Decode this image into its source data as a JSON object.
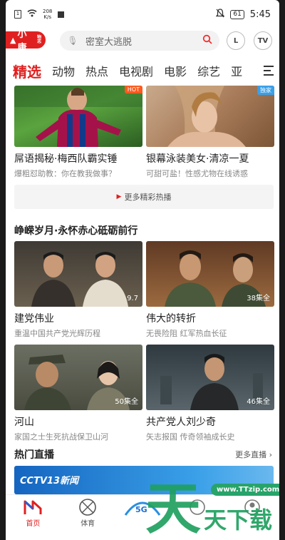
{
  "status": {
    "speed_num": "208",
    "speed_unit": "K/s",
    "battery": "61",
    "time": "5:45"
  },
  "header": {
    "logo_text": "小康",
    "logo_small": "物志",
    "search_placeholder": "密室大逃脱",
    "btn_l": "L",
    "btn_tv": "TV"
  },
  "tabs": [
    "精选",
    "动物",
    "热点",
    "电视剧",
    "电影",
    "综艺",
    "亚"
  ],
  "hot": {
    "items": [
      {
        "title": "屌语揭秘·梅西队霸实锤",
        "sub": "爆粗怼助教：你在教我做事？",
        "tag": "HOT"
      },
      {
        "title": "银幕泳装美女·清凉一夏",
        "sub": "可甜可盐！性感尤物在线诱惑",
        "tag": "独家"
      }
    ],
    "more": "更多精彩热播"
  },
  "section1": {
    "title": "峥嵘岁月·永怀赤心砥砺前行",
    "items": [
      {
        "title": "建党伟业",
        "sub": "重温中国共产党光辉历程",
        "badge": "9.7"
      },
      {
        "title": "伟大的转折",
        "sub": "无畏险阻 红军热血长征",
        "badge": "38集全"
      },
      {
        "title": "河山",
        "sub": "家国之士生死抗战保卫山河",
        "badge": "50集全"
      },
      {
        "title": "共产党人刘少奇",
        "sub": "矢志报国 传奇领袖成长史",
        "badge": "46集全"
      }
    ]
  },
  "live": {
    "title": "热门直播",
    "more": "更多直播",
    "banner": "CCTV13新闻"
  },
  "nav": [
    {
      "label": "首页",
      "icon": "home-icon"
    },
    {
      "label": "体育",
      "icon": "sports-ball-icon"
    },
    {
      "label": "",
      "icon": "5g-vip-icon"
    },
    {
      "label": "",
      "icon": "discover-icon"
    },
    {
      "label": "",
      "icon": "profile-icon"
    }
  ],
  "watermark": {
    "url": "www.TTzip.com",
    "text": "天天下载"
  },
  "colors": {
    "brand_red": "#e02020",
    "green": "#28a36a"
  }
}
